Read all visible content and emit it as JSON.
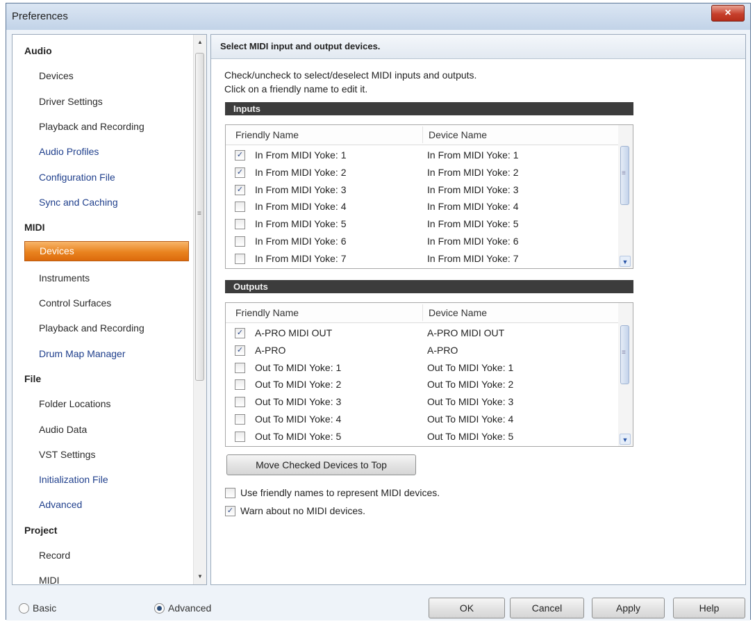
{
  "window": {
    "title": "Preferences",
    "close_glyph": "×"
  },
  "nav": {
    "items": [
      {
        "label": "Audio",
        "kind": "category"
      },
      {
        "label": "Devices",
        "kind": "sub"
      },
      {
        "label": "Driver Settings",
        "kind": "sub"
      },
      {
        "label": "Playback and Recording",
        "kind": "sub"
      },
      {
        "label": "Audio Profiles",
        "kind": "link"
      },
      {
        "label": "Configuration File",
        "kind": "link"
      },
      {
        "label": "Sync and Caching",
        "kind": "link"
      },
      {
        "label": "MIDI",
        "kind": "category"
      },
      {
        "label": "Devices",
        "kind": "selected"
      },
      {
        "label": "Instruments",
        "kind": "sub"
      },
      {
        "label": "Control Surfaces",
        "kind": "sub"
      },
      {
        "label": "Playback and Recording",
        "kind": "sub"
      },
      {
        "label": "Drum Map Manager",
        "kind": "link"
      },
      {
        "label": "File",
        "kind": "category"
      },
      {
        "label": "Folder Locations",
        "kind": "sub"
      },
      {
        "label": "Audio Data",
        "kind": "sub"
      },
      {
        "label": "VST Settings",
        "kind": "sub"
      },
      {
        "label": "Initialization File",
        "kind": "link"
      },
      {
        "label": "Advanced",
        "kind": "link"
      },
      {
        "label": "Project",
        "kind": "category"
      },
      {
        "label": "Record",
        "kind": "sub"
      },
      {
        "label": "MIDI",
        "kind": "sub"
      }
    ],
    "scroll_up_glyph": "▲",
    "scroll_down_glyph": "▼",
    "scroll_grip": "≡"
  },
  "content": {
    "header": "Select MIDI input and output devices.",
    "instructions": [
      "Check/uncheck to select/deselect MIDI inputs and outputs.",
      "Click on a friendly name to edit it."
    ],
    "inputs": {
      "title": "Inputs",
      "columns": [
        "Friendly Name",
        "Device Name"
      ],
      "rows": [
        {
          "checked": true,
          "friendly": "In From MIDI Yoke:  1",
          "device": "In From MIDI Yoke:  1"
        },
        {
          "checked": true,
          "friendly": "In From MIDI Yoke:  2",
          "device": "In From MIDI Yoke:  2"
        },
        {
          "checked": true,
          "friendly": "In From MIDI Yoke:  3",
          "device": "In From MIDI Yoke:  3"
        },
        {
          "checked": false,
          "friendly": "In From MIDI Yoke:  4",
          "device": "In From MIDI Yoke:  4"
        },
        {
          "checked": false,
          "friendly": "In From MIDI Yoke:  5",
          "device": "In From MIDI Yoke:  5"
        },
        {
          "checked": false,
          "friendly": "In From MIDI Yoke:  6",
          "device": "In From MIDI Yoke:  6"
        },
        {
          "checked": false,
          "friendly": "In From MIDI Yoke:  7",
          "device": "In From MIDI Yoke:  7"
        }
      ]
    },
    "outputs": {
      "title": "Outputs",
      "columns": [
        "Friendly Name",
        "Device Name"
      ],
      "rows": [
        {
          "checked": true,
          "friendly": "A-PRO MIDI OUT",
          "device": "A-PRO MIDI OUT"
        },
        {
          "checked": true,
          "friendly": "A-PRO",
          "device": "A-PRO"
        },
        {
          "checked": false,
          "friendly": "Out To MIDI Yoke:  1",
          "device": "Out To MIDI Yoke:  1"
        },
        {
          "checked": false,
          "friendly": "Out To MIDI Yoke:  2",
          "device": "Out To MIDI Yoke:  2"
        },
        {
          "checked": false,
          "friendly": "Out To MIDI Yoke:  3",
          "device": "Out To MIDI Yoke:  3"
        },
        {
          "checked": false,
          "friendly": "Out To MIDI Yoke:  4",
          "device": "Out To MIDI Yoke:  4"
        },
        {
          "checked": false,
          "friendly": "Out To MIDI Yoke:  5",
          "device": "Out To MIDI Yoke:  5"
        }
      ]
    },
    "list_scroll_down_glyph": "▼",
    "list_scroll_grip": "≡",
    "check_glyph": "✓",
    "move_button": "Move Checked Devices to Top",
    "options": [
      {
        "label": "Use friendly names to represent MIDI devices.",
        "checked": false
      },
      {
        "label": "Warn about no MIDI devices.",
        "checked": true
      }
    ]
  },
  "footer": {
    "radio_basic": "Basic",
    "radio_advanced": "Advanced",
    "selected_mode": "Advanced",
    "ok": "OK",
    "cancel": "Cancel",
    "apply": "Apply",
    "help": "Help"
  },
  "colors": {
    "selected_bg": "#e9831f",
    "link_text": "#1f3f8c",
    "group_bar": "#3c3c3c"
  }
}
